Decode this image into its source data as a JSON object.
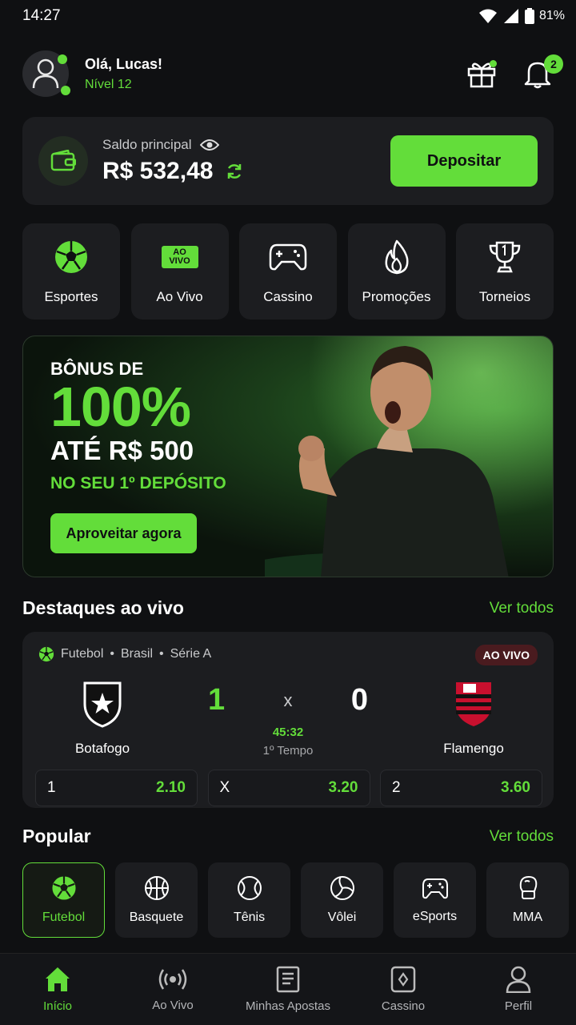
{
  "status": {
    "time": "14:27",
    "battery": "81%"
  },
  "user": {
    "greeting": "Olá, Lucas!",
    "level": "Nível 12"
  },
  "notifications": {
    "count": "2"
  },
  "balance": {
    "label": "Saldo principal",
    "amount": "R$ 532,48",
    "deposit_label": "Depositar"
  },
  "categories": [
    {
      "label": "Esportes",
      "icon": "soccer-ball-icon"
    },
    {
      "label": "Ao Vivo",
      "icon": "ao-vivo-badge",
      "badge": "AO VIVO"
    },
    {
      "label": "Cassino",
      "icon": "gamepad-icon"
    },
    {
      "label": "Promoções",
      "icon": "flame-icon"
    },
    {
      "label": "Torneios",
      "icon": "trophy-icon"
    }
  ],
  "banner": {
    "line1": "BÔNUS DE",
    "line2": "100%",
    "line3": "ATÉ R$ 500",
    "line4": "NO SEU 1º DEPÓSITO",
    "cta": "Aproveitar agora"
  },
  "live_section": {
    "title": "Destaques ao vivo",
    "see_all": "Ver todos"
  },
  "match": {
    "sport": "Futebol",
    "country": "Brasil",
    "league": "Série A",
    "live_badge": "AO VIVO",
    "home": {
      "name": "Botafogo",
      "score": "1"
    },
    "away": {
      "name": "Flamengo",
      "score": "0"
    },
    "separator": "x",
    "clock": "45:32",
    "period": "1º Tempo",
    "odds": [
      {
        "label": "1",
        "value": "2.10"
      },
      {
        "label": "X",
        "value": "3.20"
      },
      {
        "label": "2",
        "value": "3.60"
      }
    ]
  },
  "popular_section": {
    "title": "Popular",
    "see_all": "Ver todos"
  },
  "popular": [
    {
      "label": "Futebol",
      "icon": "soccer-ball-icon",
      "active": true
    },
    {
      "label": "Basquete",
      "icon": "basketball-icon"
    },
    {
      "label": "Tênis",
      "icon": "tennis-ball-icon"
    },
    {
      "label": "Vôlei",
      "icon": "volleyball-icon"
    },
    {
      "label": "eSports",
      "icon": "controller-icon"
    },
    {
      "label": "MMA",
      "icon": "boxing-glove-icon"
    }
  ],
  "bottom_nav": [
    {
      "label": "Início",
      "icon": "home-icon",
      "active": true
    },
    {
      "label": "Ao Vivo",
      "icon": "broadcast-icon"
    },
    {
      "label": "Minhas Apostas",
      "icon": "ticket-icon"
    },
    {
      "label": "Cassino",
      "icon": "card-icon"
    },
    {
      "label": "Perfil",
      "icon": "person-icon"
    }
  ],
  "colors": {
    "accent": "#63dd3a",
    "background": "#0f1012",
    "card": "#1c1d20",
    "live_badge": "#4a1b1f"
  }
}
